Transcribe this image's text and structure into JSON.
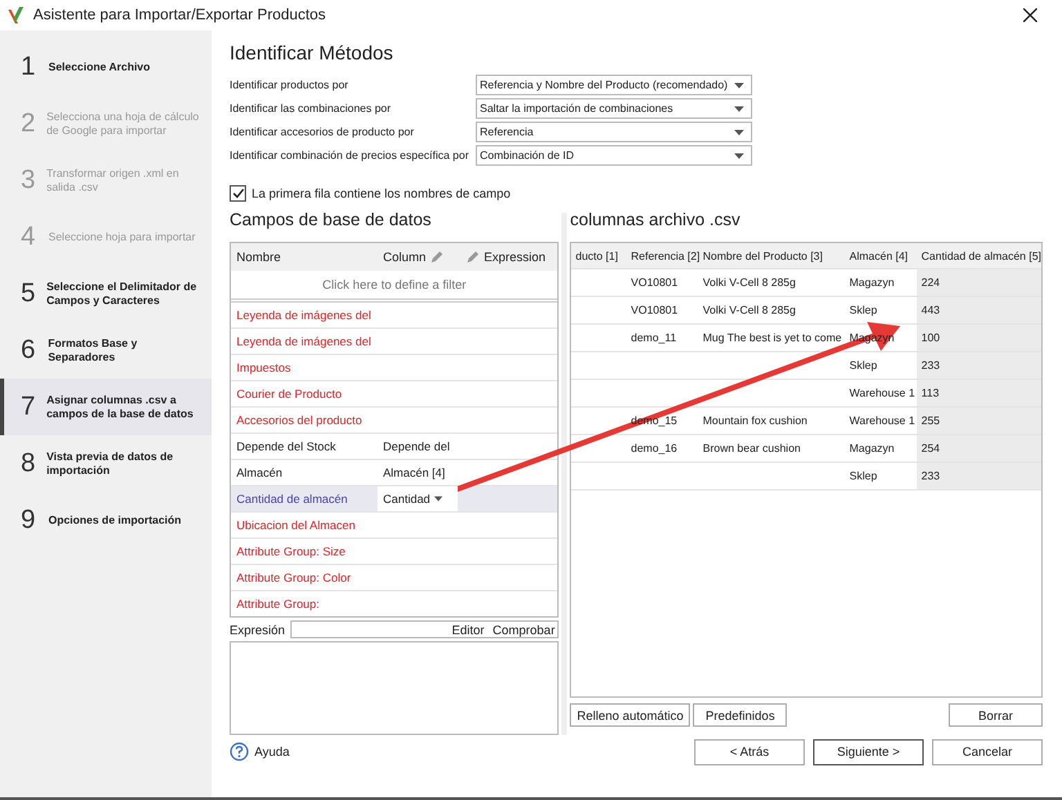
{
  "window": {
    "title": "Asistente para Importar/Exportar Productos"
  },
  "steps": [
    {
      "number": "1",
      "label": "Seleccione Archivo",
      "selected": false,
      "disabled": false
    },
    {
      "number": "2",
      "label": "Selecciona una hoja de cálculo de Google para importar",
      "selected": false,
      "disabled": true
    },
    {
      "number": "3",
      "label": "Transformar origen .xml en salida .csv",
      "selected": false,
      "disabled": true
    },
    {
      "number": "4",
      "label": "Seleccione hoja para importar",
      "selected": false,
      "disabled": true
    },
    {
      "number": "5",
      "label": "Seleccione el Delimitador de Campos y Caracteres",
      "selected": false,
      "disabled": false
    },
    {
      "number": "6",
      "label": "Formatos Base y Separadores",
      "selected": false,
      "disabled": false
    },
    {
      "number": "7",
      "label": "Asignar columnas .csv a campos de la base de datos",
      "selected": true,
      "disabled": false
    },
    {
      "number": "8",
      "label": "Vista previa de datos de importación",
      "selected": false,
      "disabled": false
    },
    {
      "number": "9",
      "label": "Opciones de importación",
      "selected": false,
      "disabled": false
    }
  ],
  "methods": {
    "title": "Identificar Métodos",
    "fields": [
      {
        "label": "Identificar productos por",
        "value": "Referencia y Nombre del Producto (recomendado)"
      },
      {
        "label": "Identificar las combinaciones por",
        "value": "Saltar la importación de combinaciones"
      },
      {
        "label": "Identificar accesorios de producto por",
        "value": "Referencia"
      },
      {
        "label": "Identificar combinación de precios específica por",
        "value": "Combinación de ID"
      }
    ]
  },
  "first_row_names": {
    "label": "La primera fila contiene los nombres de campo",
    "checked": true
  },
  "db_fields": {
    "title": "Campos de base de datos",
    "columns": [
      "Nombre",
      "Column",
      "Expression"
    ],
    "filter_hint": "Click here to define a filter",
    "rows": [
      {
        "name": "Leyenda de imágenes del",
        "column": "",
        "kind": "unmapped",
        "selected": false
      },
      {
        "name": "Leyenda de imágenes del",
        "column": "",
        "kind": "unmapped",
        "selected": false
      },
      {
        "name": "Impuestos",
        "column": "",
        "kind": "unmapped",
        "selected": false
      },
      {
        "name": "Courier de Producto",
        "column": "",
        "kind": "unmapped",
        "selected": false
      },
      {
        "name": "Accesorios del producto",
        "column": "",
        "kind": "unmapped",
        "selected": false
      },
      {
        "name": "Depende del Stock",
        "column": "Depende del",
        "kind": "mapped",
        "selected": false
      },
      {
        "name": "Almacén",
        "column": "Almacén [4]",
        "kind": "mapped",
        "selected": false
      },
      {
        "name": "Cantidad de almacén",
        "column": "Cantidad",
        "kind": "mapped",
        "selected": true
      },
      {
        "name": "Ubicacion del Almacen",
        "column": "",
        "kind": "unmapped",
        "selected": false
      },
      {
        "name": "Attribute Group: Size",
        "column": "",
        "kind": "unmapped",
        "selected": false
      },
      {
        "name": "Attribute Group: Color",
        "column": "",
        "kind": "unmapped",
        "selected": false
      },
      {
        "name": "Attribute Group:",
        "column": "",
        "kind": "unmapped",
        "selected": false
      }
    ],
    "expression_label": "Expresión",
    "editor": "Editor",
    "check": "Comprobar"
  },
  "csv": {
    "title": "columnas archivo .csv",
    "columns": [
      "ducto [1]",
      "Referencia [2]",
      "Nombre del Producto [3]",
      "Almacén [4]",
      "Cantidad de almacén [5]"
    ],
    "rows": [
      [
        "",
        "VO10801",
        "Volki V-Cell 8 285g",
        "Magazyn",
        "224"
      ],
      [
        "",
        "VO10801",
        "Volki V-Cell 8 285g",
        "Sklep",
        "443"
      ],
      [
        "",
        "demo_11",
        "Mug The best is yet to come",
        "Magazyn",
        "100"
      ],
      [
        "",
        "",
        "",
        "Sklep",
        "233"
      ],
      [
        "",
        "",
        "",
        "Warehouse 1",
        "113"
      ],
      [
        "",
        "demo_15",
        "Mountain fox cushion",
        "Warehouse 1",
        "255"
      ],
      [
        "",
        "demo_16",
        "Brown bear cushion",
        "Magazyn",
        "254"
      ],
      [
        "",
        "",
        "",
        "Sklep",
        "233"
      ]
    ],
    "buttons": [
      "Relleno automático",
      "Predefinidos",
      "Borrar"
    ]
  },
  "help": "Ayuda",
  "nav_buttons": [
    {
      "label": "< Atrás",
      "default": false
    },
    {
      "label": "Siguiente >",
      "default": true
    },
    {
      "label": "Cancelar",
      "default": false
    }
  ]
}
